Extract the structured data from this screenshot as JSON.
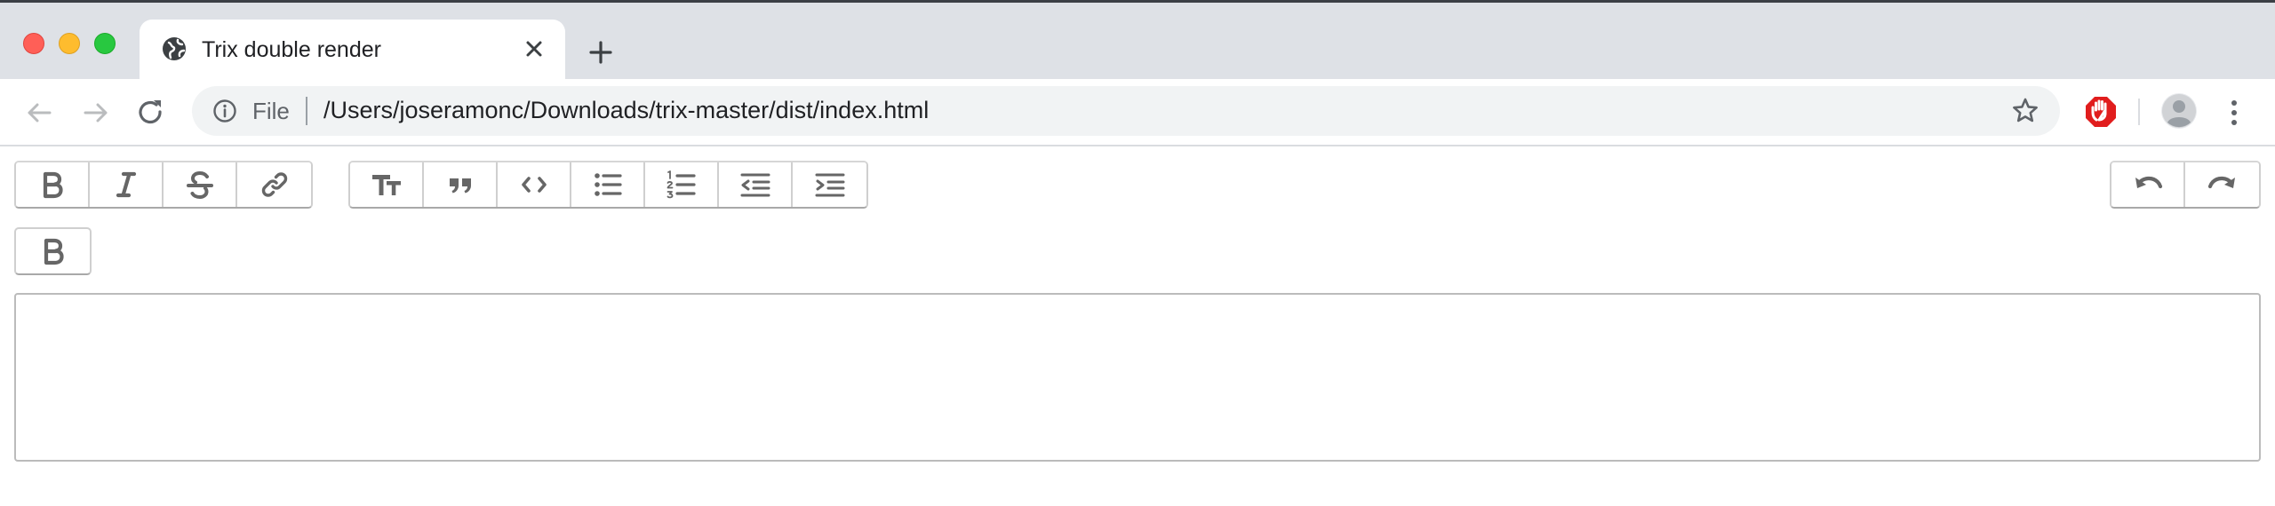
{
  "browser": {
    "tab": {
      "title": "Trix double render"
    },
    "omnibox": {
      "scheme_label": "File",
      "url": "/Users/joseramonc/Downloads/trix-master/dist/index.html"
    },
    "colors": {
      "close": "#ff5f57",
      "minimize": "#febc2e",
      "maximize": "#28c840",
      "tabstrip": "#dee1e6",
      "extension_red": "#e11d1d"
    },
    "icons": [
      "globe-icon",
      "close-icon",
      "plus-icon",
      "back-arrow-icon",
      "forward-arrow-icon",
      "reload-icon",
      "info-icon",
      "star-icon",
      "stop-hand-icon",
      "profile-icon",
      "kebab-menu-icon"
    ]
  },
  "editor_toolbar": {
    "text_tools": [
      {
        "name": "bold",
        "icon": "bold-icon"
      },
      {
        "name": "italic",
        "icon": "italic-icon"
      },
      {
        "name": "strike",
        "icon": "strikethrough-icon"
      },
      {
        "name": "link",
        "icon": "link-icon"
      }
    ],
    "block_tools": [
      {
        "name": "heading",
        "icon": "heading-icon"
      },
      {
        "name": "quote",
        "icon": "quote-icon"
      },
      {
        "name": "code",
        "icon": "code-icon"
      },
      {
        "name": "bullets",
        "icon": "bullet-list-icon"
      },
      {
        "name": "numbers",
        "icon": "numbered-list-icon"
      },
      {
        "name": "decrease-nesting",
        "icon": "outdent-icon"
      },
      {
        "name": "increase-nesting",
        "icon": "indent-icon"
      }
    ],
    "history_tools": [
      {
        "name": "undo",
        "icon": "undo-icon"
      },
      {
        "name": "redo",
        "icon": "redo-icon"
      }
    ],
    "second_toolbar": [
      {
        "name": "bold",
        "icon": "bold-icon"
      }
    ]
  },
  "editor": {
    "content": ""
  }
}
